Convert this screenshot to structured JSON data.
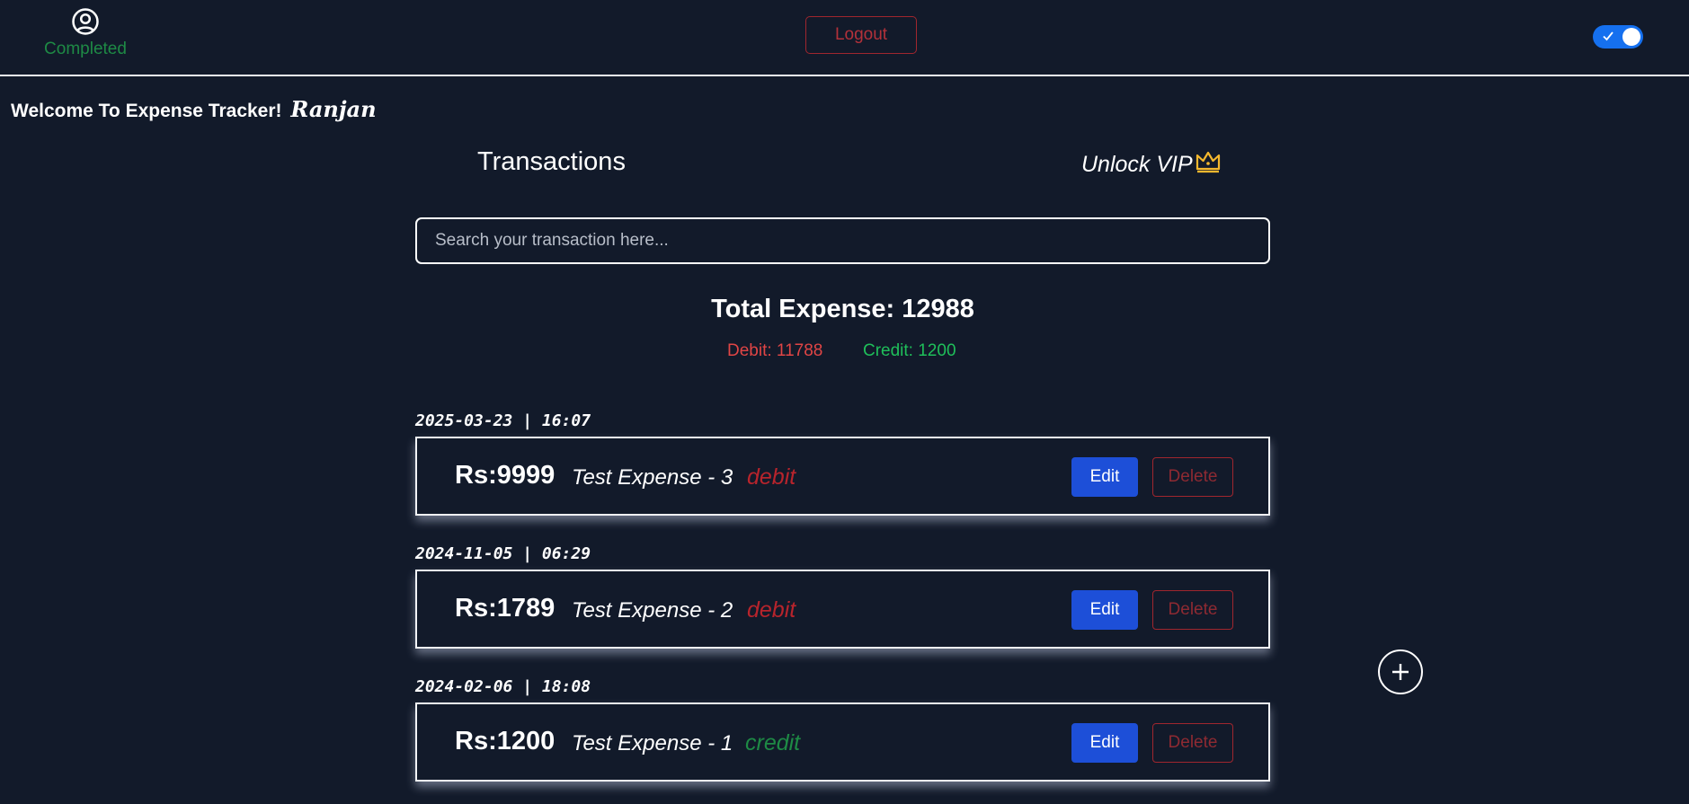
{
  "navbar": {
    "profile_status": "Completed",
    "logout_label": "Logout",
    "theme_toggle_on": true,
    "icons": {
      "profile": "user-circle-icon",
      "toggle_check": "check-icon"
    }
  },
  "welcome": {
    "text": "Welcome To Expense Tracker!",
    "name": "Ranjan"
  },
  "header": {
    "title": "Transactions",
    "vip_label": "Unlock VIP",
    "vip_icon": "crown-icon",
    "vip_icon_color": "#f5b82e"
  },
  "search": {
    "placeholder": "Search your transaction here...",
    "value": ""
  },
  "summary": {
    "total": "Total Expense: 12988",
    "debit": "Debit: 11788",
    "credit": "Credit: 1200"
  },
  "transactions": [
    {
      "date": "2025-03-23 | 16:07",
      "amount": "Rs:9999",
      "name": "Test Expense - 3",
      "type": "debit",
      "edit_label": "Edit",
      "delete_label": "Delete"
    },
    {
      "date": "2024-11-05 | 06:29",
      "amount": "Rs:1789",
      "name": "Test Expense - 2",
      "type": "debit",
      "edit_label": "Edit",
      "delete_label": "Delete"
    },
    {
      "date": "2024-02-06 | 18:08",
      "amount": "Rs:1200",
      "name": "Test Expense - 1",
      "type": "credit",
      "edit_label": "Edit",
      "delete_label": "Delete"
    }
  ],
  "add_button_icon": "plus-icon",
  "colors": {
    "background": "#121a2a",
    "debit": "#b8242c",
    "credit": "#1e8a45",
    "edit_button": "#1d4fd8",
    "toggle": "#1570ef"
  }
}
